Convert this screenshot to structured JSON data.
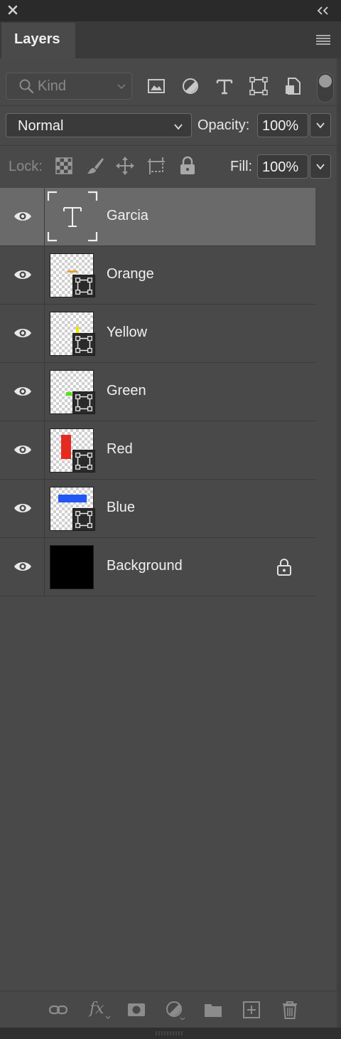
{
  "window": {
    "close_icon": "close-icon",
    "collapse_icon": "double-chevron-left-icon"
  },
  "panel": {
    "tab_label": "Layers",
    "menu_icon": "hamburger-menu-icon"
  },
  "filter": {
    "kind_label": "Kind",
    "icons": [
      "image-filter-icon",
      "adjustment-filter-icon",
      "type-filter-icon",
      "shape-filter-icon",
      "smart-object-filter-icon"
    ]
  },
  "blend": {
    "mode": "Normal",
    "opacity_label": "Opacity:",
    "opacity_value": "100%"
  },
  "lock": {
    "label": "Lock:",
    "fill_label": "Fill:",
    "fill_value": "100%",
    "icons": [
      "lock-transparent-pixels-icon",
      "lock-image-pixels-icon",
      "lock-position-icon",
      "lock-artboard-icon",
      "lock-all-icon"
    ]
  },
  "layers": [
    {
      "name": "Garcia",
      "kind": "type",
      "selected": true,
      "visible": true
    },
    {
      "name": "Orange",
      "kind": "smart-object",
      "swatch": "#e8a23a",
      "visible": true
    },
    {
      "name": "Yellow",
      "kind": "smart-object",
      "swatch": "#f2e600",
      "visible": true
    },
    {
      "name": "Green",
      "kind": "smart-object",
      "swatch": "#55e01a",
      "visible": true
    },
    {
      "name": "Red",
      "kind": "smart-object",
      "swatch": "#e62a1f",
      "visible": true
    },
    {
      "name": "Blue",
      "kind": "smart-object",
      "swatch": "#2456f5",
      "visible": true
    },
    {
      "name": "Background",
      "kind": "background",
      "locked": true,
      "visible": true
    }
  ],
  "bottom_bar": {
    "icons": [
      "link-layers-icon",
      "fx-icon",
      "layer-mask-icon",
      "adjustment-layer-icon",
      "new-group-icon",
      "new-layer-icon",
      "delete-layer-icon"
    ],
    "fx_label": "fx"
  },
  "colors": {
    "panel_bg": "#494949",
    "selected_row": "#6a6a6a",
    "chrome": "#2b2b2b"
  }
}
